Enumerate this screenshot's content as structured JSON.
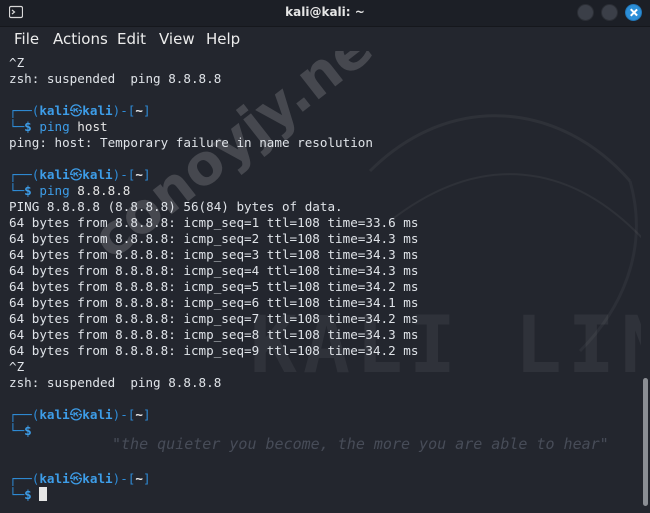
{
  "window": {
    "title": "kali@kali: ~",
    "icons": [
      "terminal-icon",
      "minimize-icon",
      "maximize-icon",
      "close-icon"
    ]
  },
  "menu": [
    "File",
    "Actions",
    "Edit",
    "View",
    "Help"
  ],
  "terminal": {
    "output1": [
      "^Z",
      "zsh: suspended  ping 8.8.8.8"
    ],
    "prompt": {
      "top_left": "┌──(",
      "user": "kali",
      "skull": "㉿",
      "host": "kali",
      "sep": ")-[",
      "dir": "~",
      "end": "]",
      "bottom_left": "└─",
      "dollar": "$"
    },
    "cmd1": {
      "name": "ping",
      "args": "host"
    },
    "output2": [
      "ping: host: Temporary failure in name resolution"
    ],
    "cmd2": {
      "name": "ping",
      "args": "8.8.8.8"
    },
    "output3": [
      "PING 8.8.8.8 (8.8.8.8) 56(84) bytes of data.",
      "64 bytes from 8.8.8.8: icmp_seq=1 ttl=108 time=33.6 ms",
      "64 bytes from 8.8.8.8: icmp_seq=2 ttl=108 time=34.3 ms",
      "64 bytes from 8.8.8.8: icmp_seq=3 ttl=108 time=34.3 ms",
      "64 bytes from 8.8.8.8: icmp_seq=4 ttl=108 time=34.3 ms",
      "64 bytes from 8.8.8.8: icmp_seq=5 ttl=108 time=34.2 ms",
      "64 bytes from 8.8.8.8: icmp_seq=6 ttl=108 time=34.1 ms",
      "64 bytes from 8.8.8.8: icmp_seq=7 ttl=108 time=34.2 ms",
      "64 bytes from 8.8.8.8: icmp_seq=8 ttl=108 time=34.3 ms",
      "64 bytes from 8.8.8.8: icmp_seq=9 ttl=108 time=34.2 ms",
      "^Z",
      "zsh: suspended  ping 8.8.8.8"
    ]
  },
  "watermark": {
    "kali_text": "KALI LINUX",
    "quote": "\"the quieter you become, the more you are able to hear\"",
    "site": "conoyjy.net"
  },
  "colors": {
    "background": "#23262e",
    "prompt_blue": "#3d9de8",
    "text": "#dfe3e8",
    "close_button": "#2c8fd8"
  }
}
